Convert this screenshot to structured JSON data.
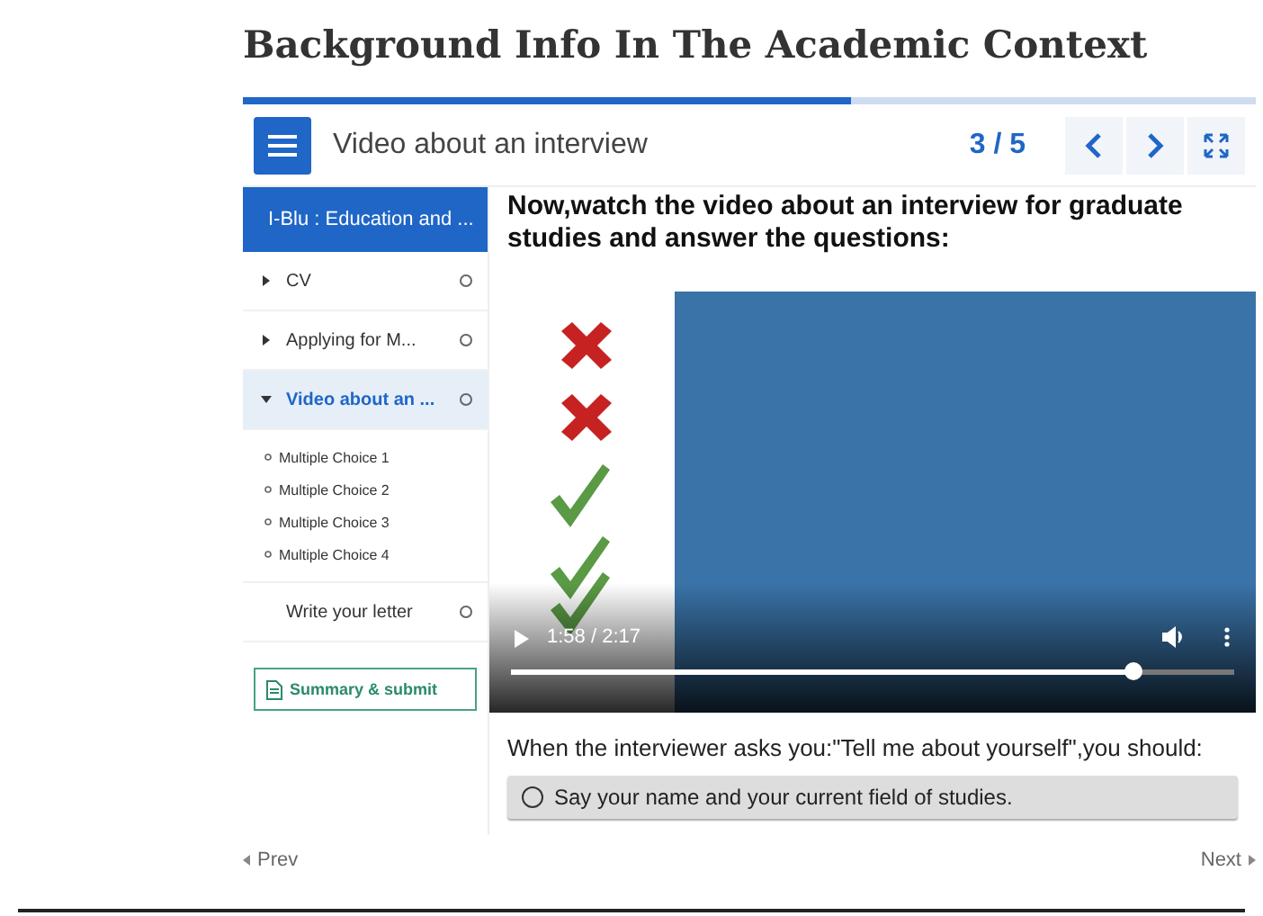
{
  "page_title": "Background Info In The Academic Context",
  "progress": {
    "level": 0.6
  },
  "header": {
    "title": "Video about an interview",
    "counter": "3 / 5"
  },
  "sidebar": {
    "course": "I-Blu : Education and ...",
    "items": [
      {
        "kind": "group",
        "label": "CV",
        "expanded": false,
        "selected": false
      },
      {
        "kind": "group",
        "label": "Applying for M...",
        "expanded": false,
        "selected": false
      },
      {
        "kind": "group",
        "label": "Video about an ...",
        "expanded": true,
        "selected": true,
        "children": [
          {
            "label": "Multiple Choice 1"
          },
          {
            "label": "Multiple Choice 2"
          },
          {
            "label": "Multiple Choice 3"
          },
          {
            "label": "Multiple Choice 4"
          }
        ]
      },
      {
        "kind": "page",
        "label": "Write your letter",
        "selected": false
      }
    ],
    "submit": "Summary & submit"
  },
  "instruction": "Now,watch the video about an interview for graduate studies and answer the questions:",
  "video": {
    "kind": "picture",
    "time": "1:58 / 2:17",
    "level": 0.86
  },
  "question": {
    "text": "When the interviewer asks you:\"Tell me about yourself\",you should:",
    "options": [
      {
        "label": "Say your name and your current field of studies.",
        "selected": false
      }
    ]
  },
  "nav": {
    "prev": "Prev",
    "next": "Next"
  }
}
